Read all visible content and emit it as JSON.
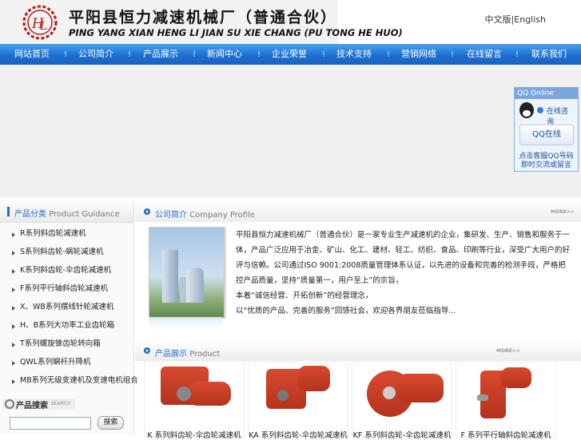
{
  "header": {
    "cn_title": "平阳县恒力减速机械厂（普通合伙）",
    "en_title": "PING YANG XIAN HENG LI JIAN SU XIE CHANG (PU TONG HE HUO)",
    "lang_cn": "中文版",
    "lang_sep": "|",
    "lang_en": "English"
  },
  "nav": [
    "网站首页",
    "公司简介",
    "产品展示",
    "新闻中心",
    "企业荣誉",
    "技术支持",
    "营销网络",
    "在线留言",
    "联系我们"
  ],
  "qq": {
    "title": "QQ Online",
    "consult": "在线咨询",
    "button": "QQ在线",
    "note": "点击客服QQ号码即时交流或留言"
  },
  "sidebar": {
    "title_cn": "产品分类",
    "title_en": "Product Guidance",
    "items": [
      "R系列斜齿轮减速机",
      "S系列斜齿轮-蜗轮减速机",
      "K系列斜齿轮-伞齿轮减速机",
      "F系列平行轴斜齿轮减速机",
      "X、WB系列摆线针轮减速机",
      "H、B系列大功率工业齿轮箱",
      "T系列螺旋锥齿轮转向箱",
      "QWL系列蜗杆升降机",
      "MB系列无级变速机及变速电机组合"
    ],
    "search_cn": "产品搜索",
    "search_en": "SEARCH",
    "search_button": "搜索"
  },
  "profile": {
    "title_cn": "公司简介",
    "title_en": "Company Profile",
    "more": "MORE>>",
    "paragraph1": "平阳县恒力减速机械厂（普通合伙）是一家专业生产减速机的企业，集研发、生产、销售和服务于一体，产品广泛应用于冶金、矿山、化工、建材、轻工、纺织、食品、印刷等行业，深受广大用户的好评与信赖。公司通过ISO 9001:2008质量管理体系认证，以先进的设备和完善的检测手段，严格把控产品质量，坚持“质量第一，用户至上”的宗旨，",
    "line_a": "本着“诚信经营、开拓创新”的经营理念，",
    "line_b": "以“优质的产品、完善的服务”回馈社会，欢迎各界朋友莅临指导..."
  },
  "products": {
    "title_cn": "产品展示",
    "title_en": "Product",
    "more": "MORE>>",
    "items": [
      "K 系列斜齿轮-伞齿轮减速机",
      "KA 系列斜齿轮-伞齿轮减速机",
      "KF 系列斜齿轮-伞齿轮减速机",
      "F 系列平行轴斜齿轮减速机"
    ]
  }
}
